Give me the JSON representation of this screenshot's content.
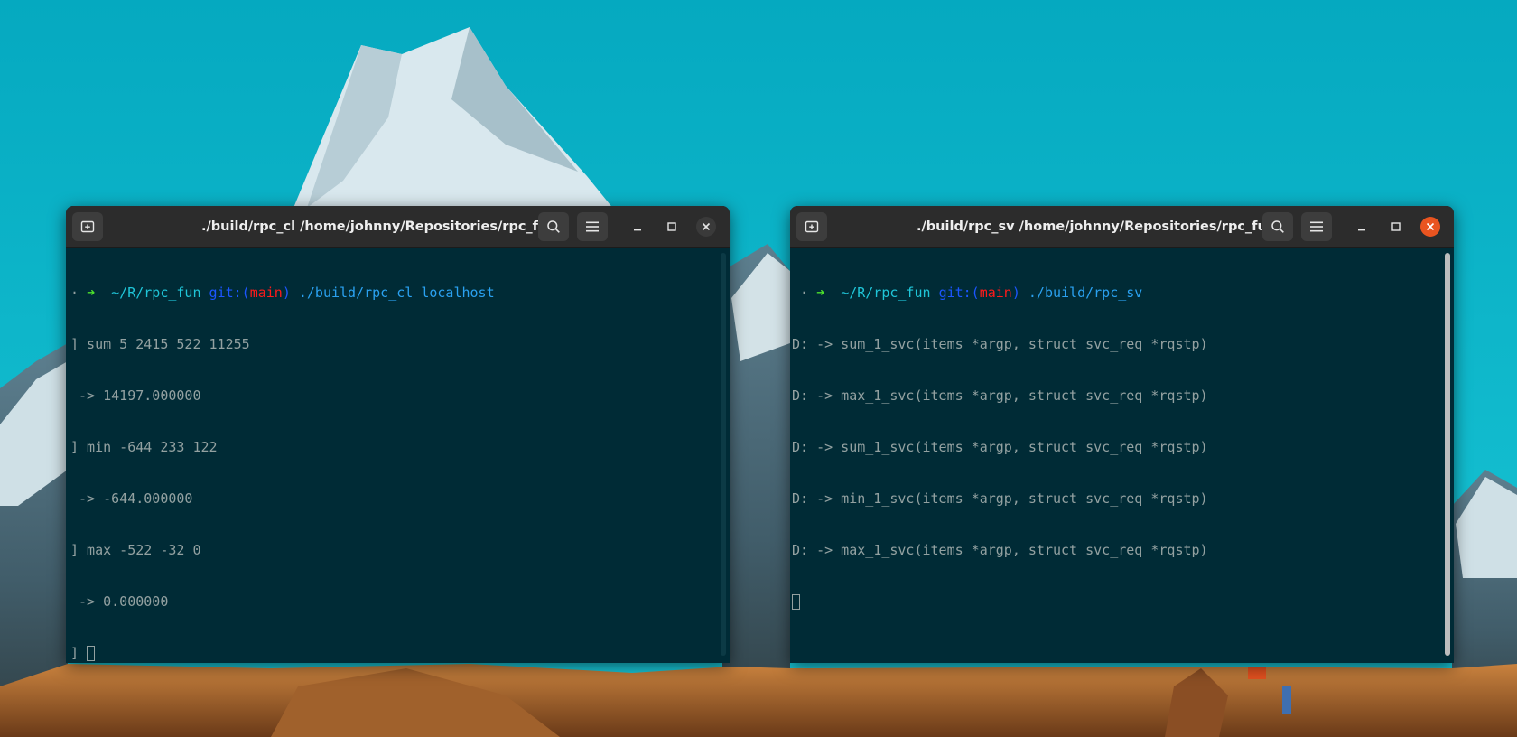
{
  "colors": {
    "terminal_bg": "#002b36",
    "titlebar_bg": "#2c2c2c",
    "close_active": "#e95420",
    "prompt_arrow": "#4ce02c",
    "path": "#1fc5d8",
    "git_label": "#1b56ff",
    "branch": "#ff1a1a",
    "command": "#2aa1f0",
    "text": "#93a1a1"
  },
  "icons": {
    "new_tab": "new-tab-icon",
    "search": "search-icon",
    "menu": "hamburger-menu-icon",
    "minimize": "minimize-icon",
    "maximize": "maximize-icon",
    "close": "close-icon"
  },
  "client_window": {
    "title": "./build/rpc_cl /home/johnny/Repositories/rpc_fun",
    "prompt": {
      "dot": "·",
      "arrow": "➜",
      "path": "~/R/rpc_fun",
      "git_open": "git:(",
      "branch": "main",
      "git_close": ")",
      "command": "./build/rpc_cl localhost"
    },
    "lines": [
      "] sum 5 2415 522 11255",
      " -> 14197.000000",
      "] min -644 233 122",
      " -> -644.000000",
      "] max -522 -32 0",
      " -> 0.000000"
    ],
    "cursor_prefix": "] "
  },
  "server_window": {
    "title": "./build/rpc_sv /home/johnny/Repositories/rpc_fun",
    "prompt": {
      "dot": "·",
      "arrow": "➜",
      "path": "~/R/rpc_fun",
      "git_open": "git:(",
      "branch": "main",
      "git_close": ")",
      "command": "./build/rpc_sv"
    },
    "lines": [
      "D: -> sum_1_svc(items *argp, struct svc_req *rqstp)",
      "D: -> max_1_svc(items *argp, struct svc_req *rqstp)",
      "D: -> sum_1_svc(items *argp, struct svc_req *rqstp)",
      "D: -> min_1_svc(items *argp, struct svc_req *rqstp)",
      "D: -> max_1_svc(items *argp, struct svc_req *rqstp)"
    ]
  }
}
